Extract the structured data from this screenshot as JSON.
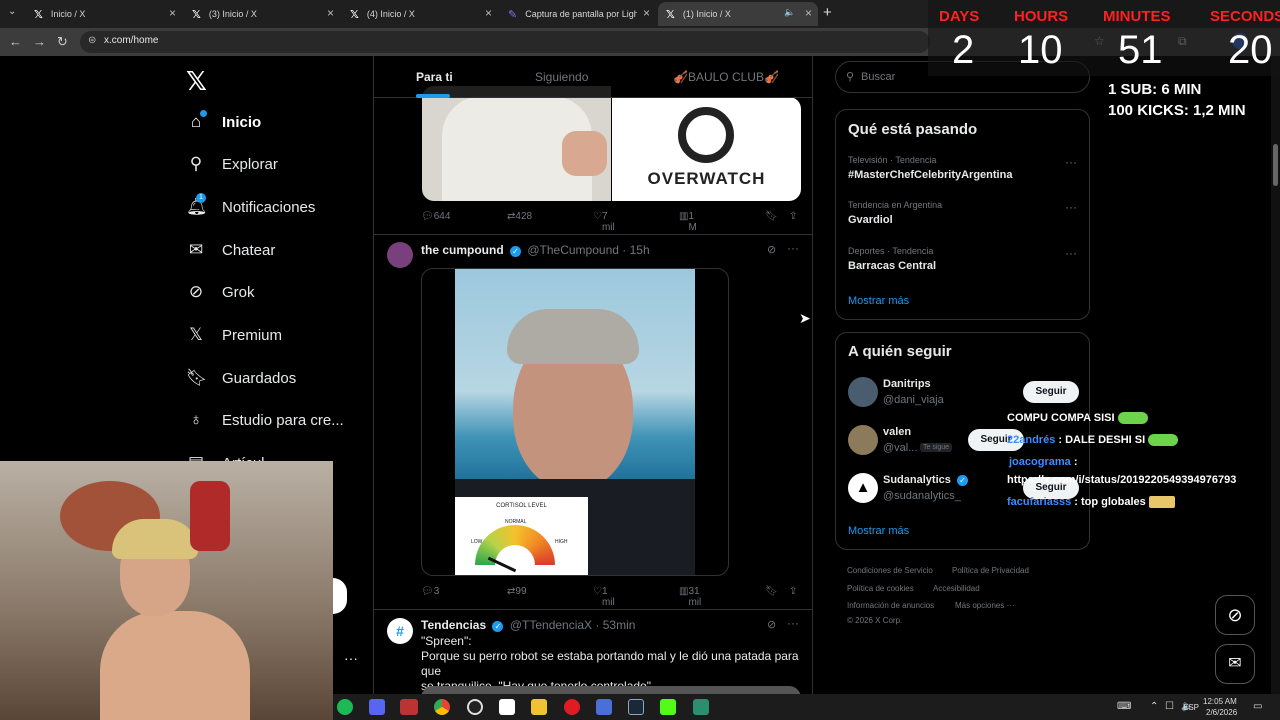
{
  "browser": {
    "tabs": [
      {
        "label": "Inicio / X"
      },
      {
        "label": "(3) Inicio / X"
      },
      {
        "label": "(4) Inicio / X"
      },
      {
        "label": "Captura de pantalla por Lightsh"
      },
      {
        "label": "(1) Inicio / X"
      }
    ],
    "url": "x.com/home"
  },
  "nav": {
    "items": [
      {
        "label": "Inicio",
        "icon": "home-icon"
      },
      {
        "label": "Explorar",
        "icon": "search-icon"
      },
      {
        "label": "Notificaciones",
        "icon": "bell-icon",
        "badge": "1"
      },
      {
        "label": "Chatear",
        "icon": "mail-icon"
      },
      {
        "label": "Grok",
        "icon": "grok-icon"
      },
      {
        "label": "Premium",
        "icon": "x-icon"
      },
      {
        "label": "Guardados",
        "icon": "bookmark-icon"
      },
      {
        "label": "Estudio para cre...",
        "icon": "creator-studio-icon"
      },
      {
        "label": "Artícul",
        "icon": "article-icon"
      }
    ]
  },
  "feed": {
    "tabs": [
      "Para ti",
      "Siguiendo",
      "🎻BAULO CLUB🎻"
    ],
    "tweet1": {
      "image_text": "OVERWATCH",
      "stats": {
        "replies": "644",
        "retweets": "428",
        "likes": "7 mil",
        "views": "1 M"
      }
    },
    "tweet2": {
      "name": "the cumpound",
      "handle": "@TheCumpound",
      "time": "· 15h",
      "gauge_title": "CORTISOL LEVEL",
      "gauge_labels": {
        "low": "LOW",
        "normal": "NORMAL",
        "high": "HIGH"
      },
      "stats": {
        "replies": "3",
        "retweets": "99",
        "likes": "1 mil",
        "views": "31 mil"
      }
    },
    "tweet3": {
      "name": "Tendencias",
      "handle": "@TTendenciaX",
      "time": "· 53min",
      "line1": "\"Spreen\":",
      "line2": "Porque su perro robot se estaba portando mal y le dió una patada para que",
      "line3": "se tranquilice. \"Hay que tenerlo controlado\"."
    }
  },
  "right": {
    "search_placeholder": "Buscar",
    "trends_title": "Qué está pasando",
    "trends": [
      {
        "category": "Televisión · Tendencia",
        "name": "#MasterChefCelebrityArgentina"
      },
      {
        "category": "Tendencia en Argentina",
        "name": "Gvardiol"
      },
      {
        "category": "Deportes · Tendencia",
        "name": "Barracas Central"
      }
    ],
    "show_more": "Mostrar más",
    "follow_title": "A quién seguir",
    "follow": [
      {
        "name": "Danitrips",
        "handle": "@dani_viaja",
        "button": "Seguir"
      },
      {
        "name": "valen",
        "handle": "@val...",
        "tag": "Te sigue",
        "button": "Seguir"
      },
      {
        "name": "Sudanalytics",
        "handle": "@sudanalytics_",
        "button": "Seguir"
      }
    ],
    "footer": {
      "terms": "Condiciones de Servicio",
      "privacy": "Política de Privacidad",
      "cookies": "Política de cookies",
      "accessibility": "Accesibilidad",
      "ads": "Información de anuncios",
      "more": "Más opciones ···",
      "copyright": "© 2026 X Corp."
    }
  },
  "overlay": {
    "labels": {
      "days": "DAYS",
      "hours": "HOURS",
      "minutes": "MINUTES",
      "seconds": "SECONDS"
    },
    "values": {
      "days": "2",
      "hours": "10",
      "minutes": "51",
      "seconds": "20"
    },
    "sub_rule": "1 SUB: 6 MIN",
    "kicks_rule": "100 KICKS: 1,2 MIN",
    "chat": [
      {
        "user": "",
        "text": "COMPU COMPA SISI"
      },
      {
        "user": "22andrés",
        "text": ": DALE DESHI SI"
      },
      {
        "user": "joacograma",
        "text": ":"
      },
      {
        "user": "",
        "text": "https://x.com/i/status/2019220549394976793"
      },
      {
        "user": "facufariasss",
        "text": ": top globales"
      }
    ]
  },
  "taskbar": {
    "lang": "ESP",
    "time": "12:05 AM",
    "date": "2/6/2026"
  }
}
